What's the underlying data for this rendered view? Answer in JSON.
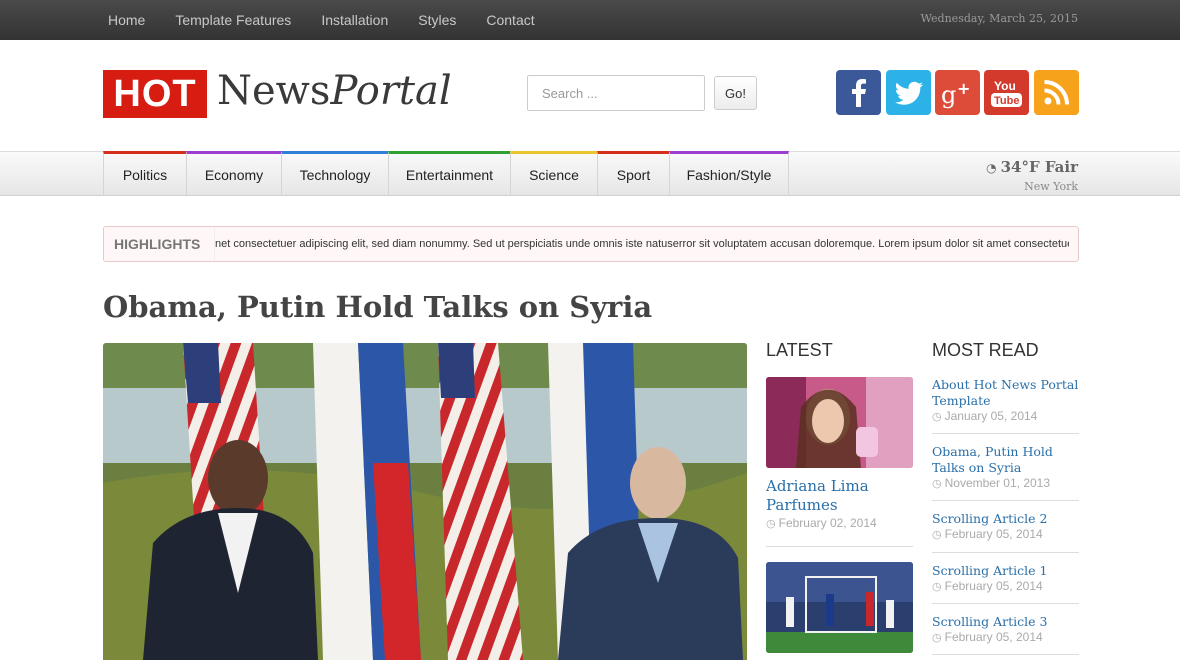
{
  "topnav": {
    "items": [
      "Home",
      "Template Features",
      "Installation",
      "Styles",
      "Contact"
    ],
    "date": "Wednesday, March 25, 2015"
  },
  "logo": {
    "hot": "HOT",
    "news": "News",
    "portal": "Portal"
  },
  "search": {
    "placeholder": "Search ...",
    "button": "Go!"
  },
  "social": [
    "facebook-icon",
    "twitter-icon",
    "google-plus-icon",
    "youtube-icon",
    "rss-icon"
  ],
  "categories": [
    {
      "label": "Politics",
      "color": "#d6301c"
    },
    {
      "label": "Economy",
      "color": "#9b3fd0"
    },
    {
      "label": "Technology",
      "color": "#2d7fd6"
    },
    {
      "label": "Entertainment",
      "color": "#31a231"
    },
    {
      "label": "Science",
      "color": "#e8c531"
    },
    {
      "label": "Sport",
      "color": "#d6301c"
    },
    {
      "label": "Fashion/Style",
      "color": "#9b3fd0"
    }
  ],
  "weather": {
    "temp": "34°F Fair",
    "city": "New York"
  },
  "highlights": {
    "label": "HIGHLIGHTS",
    "text": "net consectetuer adipiscing elit, sed diam nonummy. Sed ut perspiciatis unde omnis iste natuserror sit voluptatem accusan doloremque. Lorem ipsum dolor sit amet consectetuer"
  },
  "headline": "Obama, Putin Hold Talks on Syria",
  "latest": {
    "heading": "LATEST",
    "items": [
      {
        "title": "Adriana Lima Parfumes",
        "date": "February 02, 2014"
      }
    ]
  },
  "most_read": {
    "heading": "MOST READ",
    "items": [
      {
        "title": "About Hot News Portal Template",
        "date": "January 05, 2014"
      },
      {
        "title": "Obama, Putin Hold Talks on Syria",
        "date": "November 01, 2013"
      },
      {
        "title": "Scrolling Article 2",
        "date": "February 05, 2014"
      },
      {
        "title": "Scrolling Article 1",
        "date": "February 05, 2014"
      },
      {
        "title": "Scrolling Article 3",
        "date": "February 05, 2014"
      }
    ]
  }
}
